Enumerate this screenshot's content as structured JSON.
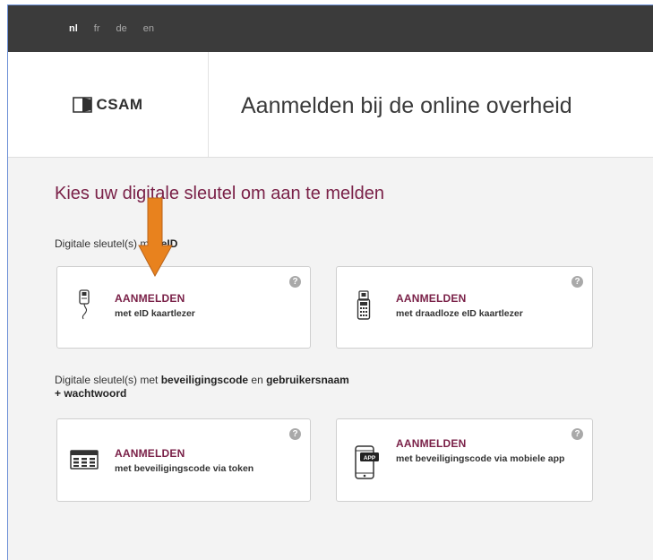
{
  "languages": [
    {
      "code": "nl",
      "active": true
    },
    {
      "code": "fr",
      "active": false
    },
    {
      "code": "de",
      "active": false
    },
    {
      "code": "en",
      "active": false
    }
  ],
  "header": {
    "logo_text": "CSAM",
    "title": "Aanmelden bij de online overheid"
  },
  "main": {
    "heading": "Kies uw digitale sleutel om aan te melden",
    "section1": {
      "label_prefix": "Digitale sleutel(s) met ",
      "label_bold": "eID"
    },
    "section2": {
      "label_prefix": "Digitale sleutel(s) met ",
      "label_bold1": "beveiligingscode",
      "label_mid": " en ",
      "label_bold2": "gebruikersnaam",
      "label_line2": "+ wachtwoord"
    },
    "cards": [
      {
        "title": "AANMELDEN",
        "subtitle": "met eID kaartlezer",
        "icon": "card-reader-icon"
      },
      {
        "title": "AANMELDEN",
        "subtitle": "met draadloze eID kaartlezer",
        "icon": "wireless-card-reader-icon"
      },
      {
        "title": "AANMELDEN",
        "subtitle": "met beveiligingscode via token",
        "icon": "token-icon"
      },
      {
        "title": "AANMELDEN",
        "subtitle": "met beveiligingscode via mobiele app",
        "icon": "mobile-app-icon"
      }
    ],
    "help_symbol": "?",
    "app_badge": "APP"
  },
  "colors": {
    "accent": "#7a2148",
    "topbar": "#3b3b3b",
    "annotation_arrow": "#e8821e"
  }
}
